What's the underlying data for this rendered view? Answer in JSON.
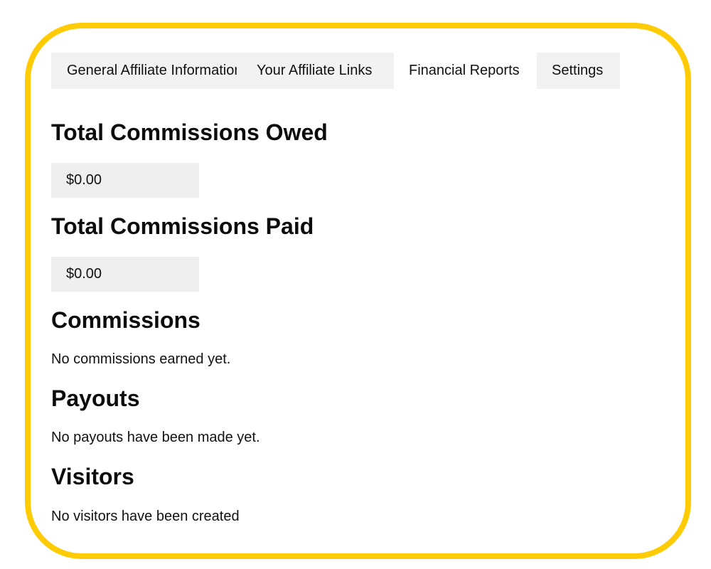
{
  "tabs": [
    {
      "label": "General Affiliate Information",
      "active": false
    },
    {
      "label": "Your Affiliate Links",
      "active": false
    },
    {
      "label": "Financial Reports",
      "active": true
    },
    {
      "label": "Settings",
      "active": false
    }
  ],
  "sections": {
    "owed": {
      "title": "Total Commissions Owed",
      "amount": "$0.00"
    },
    "paid": {
      "title": "Total Commissions Paid",
      "amount": "$0.00"
    },
    "commissions": {
      "title": "Commissions",
      "message": "No commissions earned yet."
    },
    "payouts": {
      "title": "Payouts",
      "message": "No payouts have been made yet."
    },
    "visitors": {
      "title": "Visitors",
      "message": "No visitors have been created"
    }
  },
  "colors": {
    "frame_border": "#ffcb05",
    "tab_background": "#f2f2f2",
    "active_tab_background": "#ffffff",
    "amount_box_background": "#efefef"
  }
}
